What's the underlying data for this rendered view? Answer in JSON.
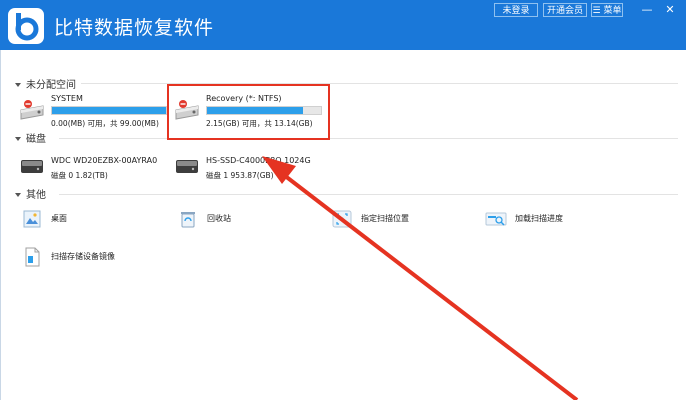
{
  "app": {
    "title": "比特数据恢复软件",
    "buttons": {
      "login": "未登录",
      "vip": "开通会员",
      "menu": "☰ 菜单"
    },
    "window_controls": {
      "minimize": "—",
      "close": "✕"
    }
  },
  "sections": {
    "unallocated": {
      "title": "未分配空间",
      "drives": [
        {
          "name": "SYSTEM",
          "stats": "0.00(MB) 可用，共 99.00(MB)",
          "used_fraction": 1.0
        },
        {
          "name": "Recovery (*: NTFS)",
          "stats": "2.15(GB) 可用，共 13.14(GB)",
          "used_fraction": 0.84
        }
      ]
    },
    "disks": {
      "title": "磁盘",
      "items": [
        {
          "name": "WDC WD20EZBX-00AYRA0",
          "stats": "磁盘 0      1.82(TB)"
        },
        {
          "name": "HS-SSD-C4000E8O 1024G",
          "stats": "磁盘 1      953.87(GB)"
        }
      ]
    },
    "others": {
      "title": "其他",
      "items": [
        {
          "label": "桌面",
          "icon": "desktop-icon"
        },
        {
          "label": "回收站",
          "icon": "recycle-bin-icon"
        },
        {
          "label": "指定扫描位置",
          "icon": "scan-location-icon"
        },
        {
          "label": "加载扫描进度",
          "icon": "load-progress-icon"
        },
        {
          "label": "扫描存储设备镜像",
          "icon": "disk-image-icon"
        }
      ]
    }
  },
  "colors": {
    "titlebar": "#1a78d9",
    "bar_fill": "#2d9fea",
    "highlight": "#e53321"
  }
}
